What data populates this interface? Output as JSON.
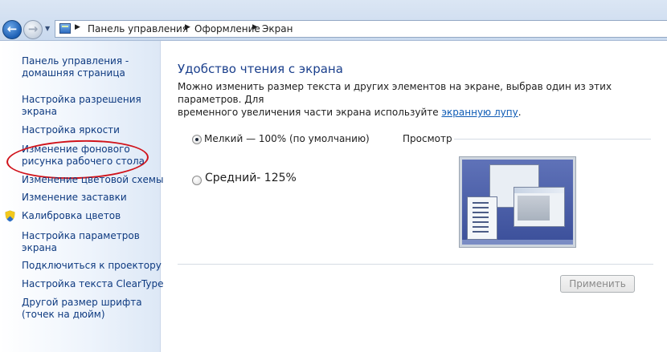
{
  "breadcrumb": [
    "Панель управления",
    "Оформление",
    "Экран"
  ],
  "icons": {
    "back": "back-arrow-icon",
    "forward": "forward-arrow-icon",
    "control_panel": "control-panel-icon",
    "shield": "uac-shield-icon"
  },
  "sidebar": {
    "items": [
      {
        "label": "Панель управления -\nдомашняя страница"
      },
      {
        "label": "Настройка разрешения\nэкрана"
      },
      {
        "label": "Настройка яркости"
      },
      {
        "label": "Изменение фонового\nрисунка рабочего стола"
      },
      {
        "label": "Изменение цветовой схемы"
      },
      {
        "label": "Изменение заставки"
      },
      {
        "label": "Калибровка цветов"
      },
      {
        "label": "Настройка параметров\nэкрана"
      },
      {
        "label": "Подключиться к проектору"
      },
      {
        "label": "Настройка текста ClearType"
      },
      {
        "label": "Другой размер шрифта\n(точек на дюйм)"
      }
    ],
    "highlight_color": "#d0121a"
  },
  "main": {
    "title": "Удобство чтения с экрана",
    "description_line1": "Можно изменить размер текста и других элементов на экране, выбрав один из этих параметров. Для",
    "description_line2": "временного увеличения части экрана используйте",
    "magnifier_link": "экранную лупу",
    "description_end": ".",
    "options": [
      {
        "label": "Мелкий — 100% (по умолчанию)",
        "selected": true
      },
      {
        "label": "Средний- 125%",
        "selected": false
      }
    ],
    "preview_label": "Просмотр",
    "apply_button": "Применить"
  },
  "colors": {
    "link": "#0e3a80",
    "title": "#1a3f8c"
  }
}
